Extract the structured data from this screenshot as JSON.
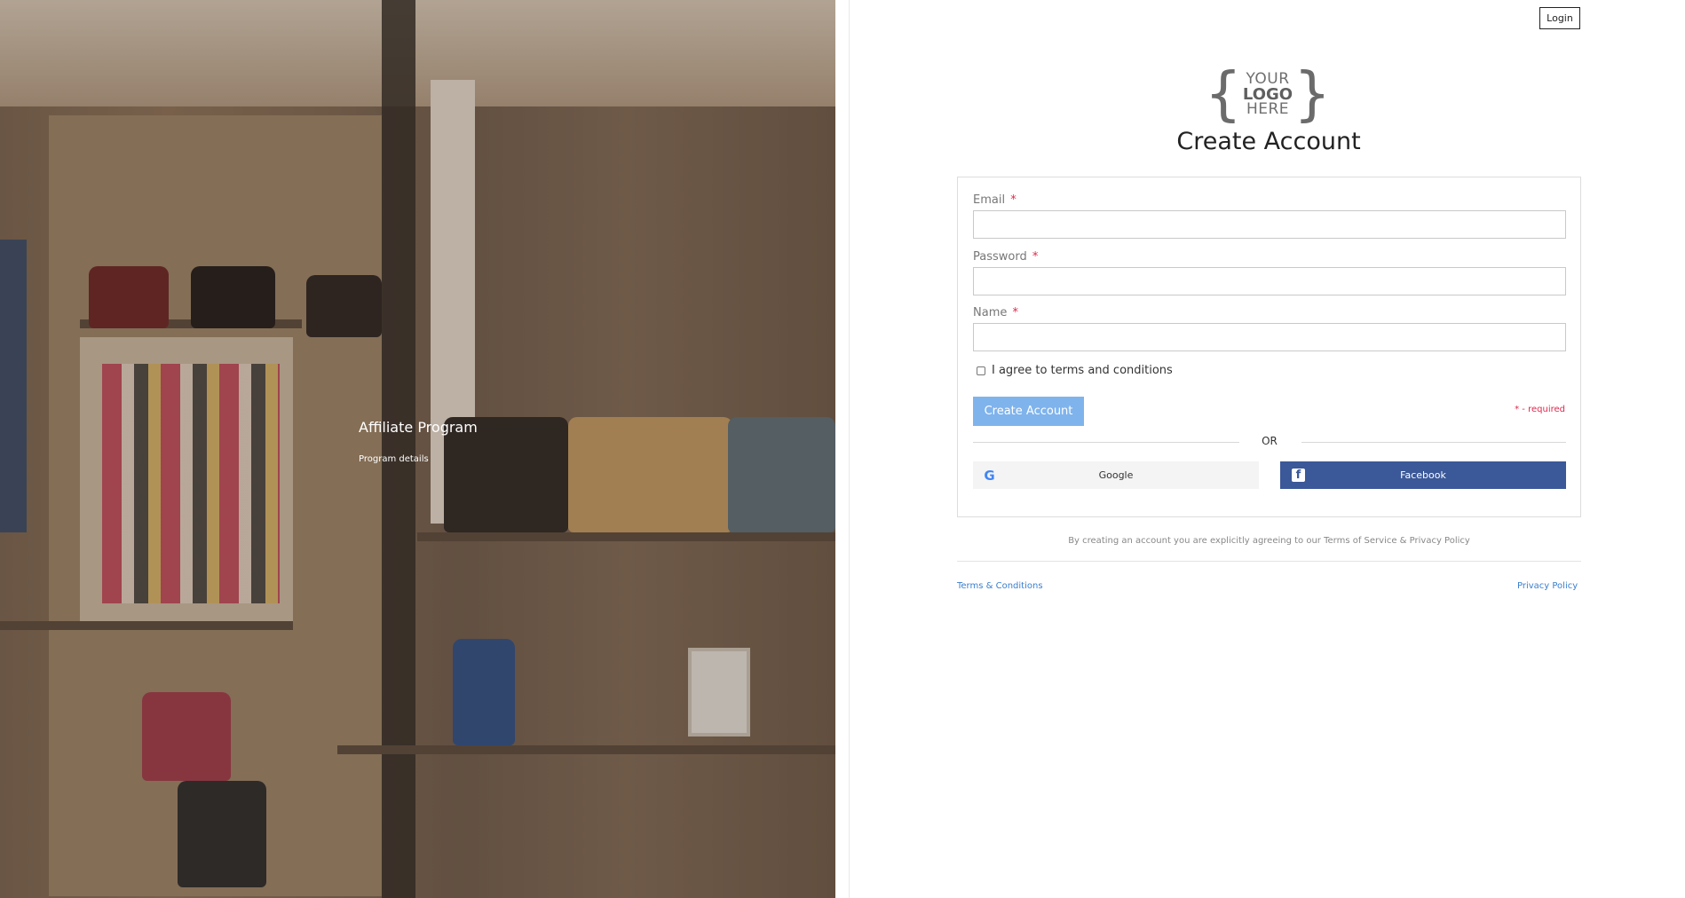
{
  "hero": {
    "title": "Affiliate Program",
    "subtitle": "Program details"
  },
  "header": {
    "login_label": "Login"
  },
  "logo": {
    "line1": "YOUR",
    "line2": "LOGO",
    "line3": "HERE"
  },
  "form": {
    "heading": "Create Account",
    "email_label": "Email",
    "password_label": "Password",
    "name_label": "Name",
    "required_mark": "*",
    "agree_label": "I agree to terms and conditions",
    "agree_checked": false,
    "submit_label": "Create Account",
    "required_note": "* - required",
    "or_label": "OR",
    "google_label": "Google",
    "facebook_label": "Facebook",
    "google_icon": "google-g-icon",
    "facebook_icon": "facebook-f-icon"
  },
  "legal": {
    "notice": "By creating an account you are explicitly agreeing to our Terms of Service & Privacy Policy",
    "terms_link": "Terms & Conditions",
    "privacy_link": "Privacy Policy"
  },
  "colors": {
    "accent_button": "#7fb3ec",
    "required": "#e0284d",
    "facebook": "#3b5898",
    "link": "#3a7fcf"
  }
}
